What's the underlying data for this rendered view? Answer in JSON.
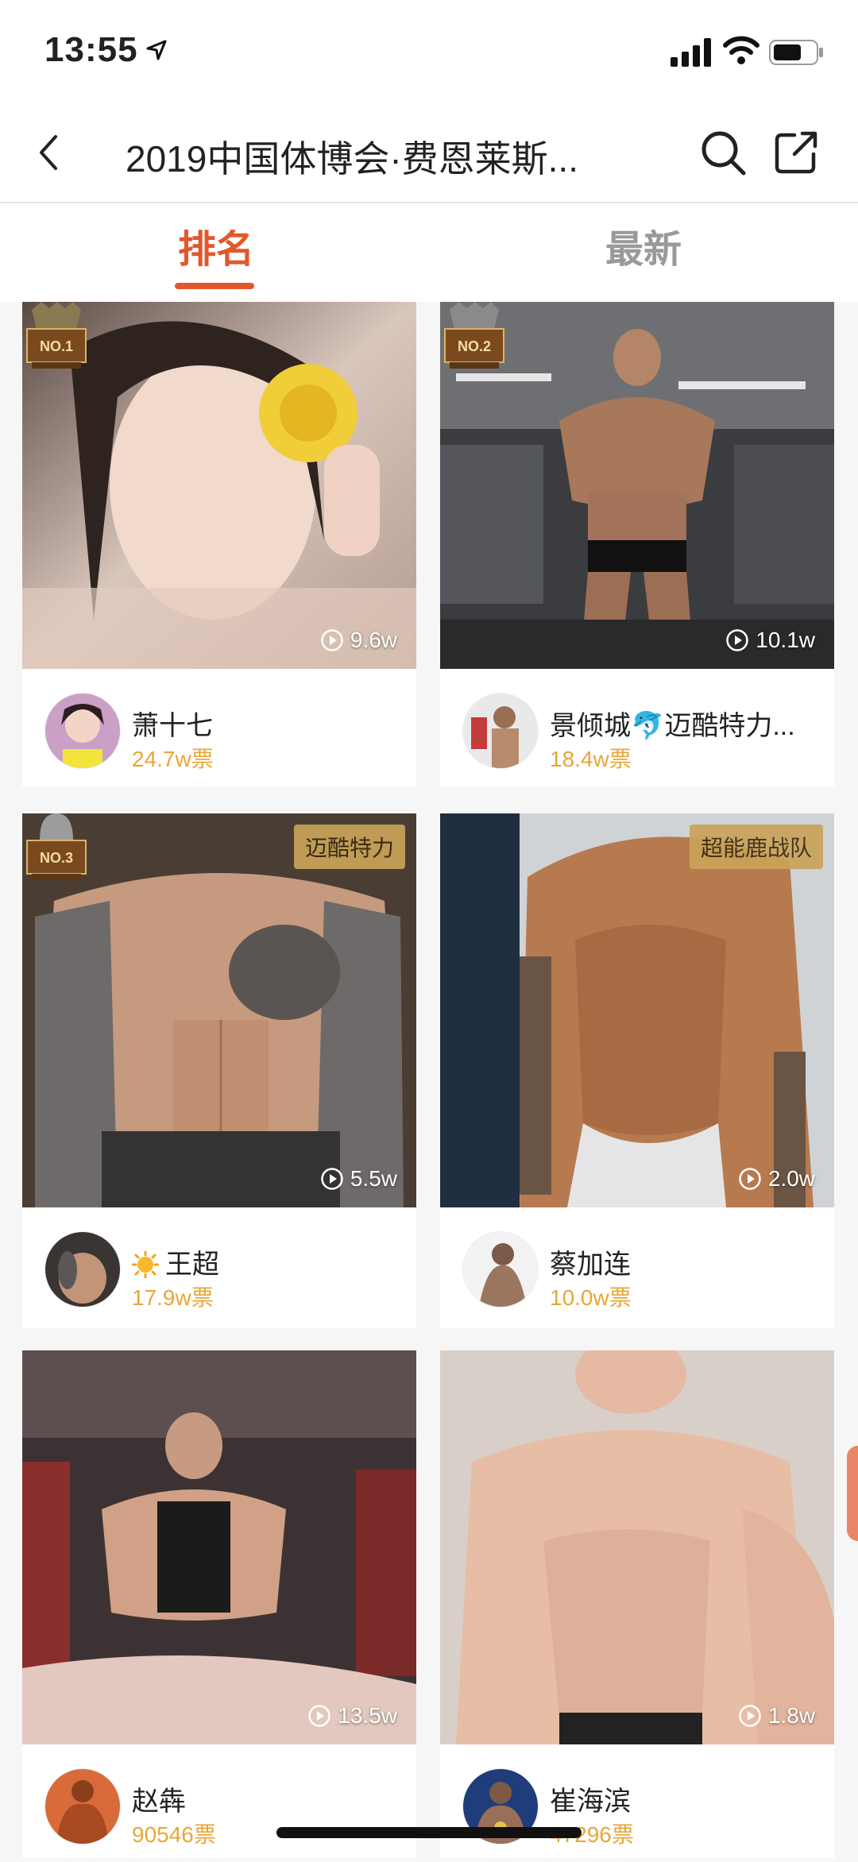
{
  "status_bar": {
    "time": "13:55"
  },
  "nav": {
    "title": "2019中国体博会·费恩莱斯..."
  },
  "tabs": [
    {
      "label": "排名"
    },
    {
      "label": "最新"
    }
  ],
  "cards": [
    {
      "rank_label": "NO.1",
      "plays": "9.6w",
      "name": "萧十七",
      "votes": "24.7w票",
      "tag": ""
    },
    {
      "rank_label": "NO.2",
      "plays": "10.1w",
      "name": "景倾城🐬迈酷特力...",
      "votes": "18.4w票",
      "tag": ""
    },
    {
      "rank_label": "NO.3",
      "plays": "5.5w",
      "name": "王超",
      "votes": "17.9w票",
      "tag": "迈酷特力"
    },
    {
      "rank_label": "",
      "plays": "2.0w",
      "name": "蔡加连",
      "votes": "10.0w票",
      "tag": "超能鹿战队"
    },
    {
      "rank_label": "",
      "plays": "13.5w",
      "name": "赵犇",
      "votes": "90546票",
      "tag": ""
    },
    {
      "rank_label": "",
      "plays": "1.8w",
      "name": "崔海滨",
      "votes": "47296票",
      "tag": ""
    }
  ],
  "colors": {
    "accent": "#e2572c",
    "votes": "#e8a637",
    "tag_bg": "#c9a35a"
  },
  "icons": [
    "location-arrow-icon",
    "signal-icon",
    "wifi-icon",
    "battery-icon",
    "back-chevron-icon",
    "search-icon",
    "share-icon",
    "play-icon",
    "sun-emoji-icon"
  ]
}
